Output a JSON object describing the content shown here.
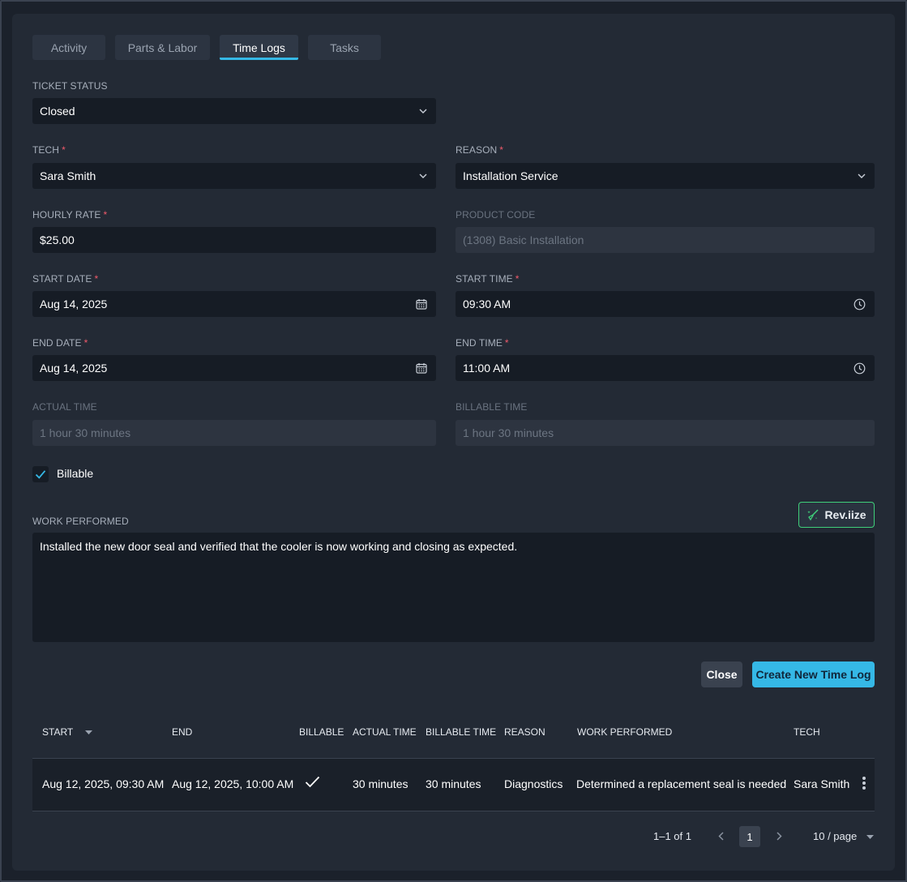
{
  "tabs": [
    {
      "label": "Activity"
    },
    {
      "label": "Parts & Labor"
    },
    {
      "label": "Time Logs"
    },
    {
      "label": "Tasks"
    }
  ],
  "active_tab": "Time Logs",
  "form": {
    "ticket_status": {
      "label": "TICKET STATUS",
      "value": "Closed"
    },
    "tech": {
      "label": "TECH",
      "value": "Sara Smith",
      "required_mark": "*"
    },
    "reason": {
      "label": "REASON",
      "value": "Installation Service",
      "required_mark": "*"
    },
    "hourly_rate": {
      "label": "HOURLY RATE",
      "value": "$25.00",
      "required_mark": "*"
    },
    "product_code": {
      "label": "PRODUCT CODE",
      "value": "(1308) Basic Installation"
    },
    "start_date": {
      "label": "START DATE",
      "value": "Aug 14, 2025",
      "required_mark": "*"
    },
    "start_time": {
      "label": "START TIME",
      "value": "09:30 AM",
      "required_mark": "*"
    },
    "end_date": {
      "label": "END DATE",
      "value": "Aug 14, 2025",
      "required_mark": "*"
    },
    "end_time": {
      "label": "END TIME",
      "value": "11:00 AM",
      "required_mark": "*"
    },
    "actual_time": {
      "label": "ACTUAL TIME",
      "value": "1 hour 30 minutes"
    },
    "billable_time": {
      "label": "BILLABLE TIME",
      "value": "1 hour 30 minutes"
    },
    "billable": {
      "label": "Billable",
      "checked": true
    },
    "work_performed": {
      "label": "WORK PERFORMED",
      "value": "Installed the new door seal and verified that the cooler is now working and closing as expected."
    },
    "revize_label": "Rev.iize"
  },
  "actions": {
    "close_label": "Close",
    "create_label": "Create New Time Log"
  },
  "table": {
    "columns": [
      "START",
      "END",
      "BILLABLE",
      "ACTUAL TIME",
      "BILLABLE TIME",
      "REASON",
      "WORK PERFORMED",
      "TECH"
    ],
    "rows": [
      {
        "start": "Aug 12, 2025, 09:30 AM",
        "end": "Aug 12, 2025, 10:00 AM",
        "billable": true,
        "actual_time": "30 minutes",
        "billable_time": "30 minutes",
        "reason": "Diagnostics",
        "work_performed": "Determined a replacement seal is needed",
        "tech": "Sara Smith"
      }
    ]
  },
  "pagination": {
    "range": "1–1 of 1",
    "current_page": "1",
    "page_size": "10 / page"
  },
  "colors": {
    "accent": "#35b8e6",
    "required": "#f05a6b",
    "revize_border": "#3fcf7a"
  },
  "icons": [
    "chevron-down-icon",
    "calendar-icon",
    "clock-icon",
    "check-icon",
    "broom-sparkle-icon",
    "kebab-icon",
    "chevron-left-icon",
    "chevron-right-icon",
    "sort-caret-icon"
  ]
}
